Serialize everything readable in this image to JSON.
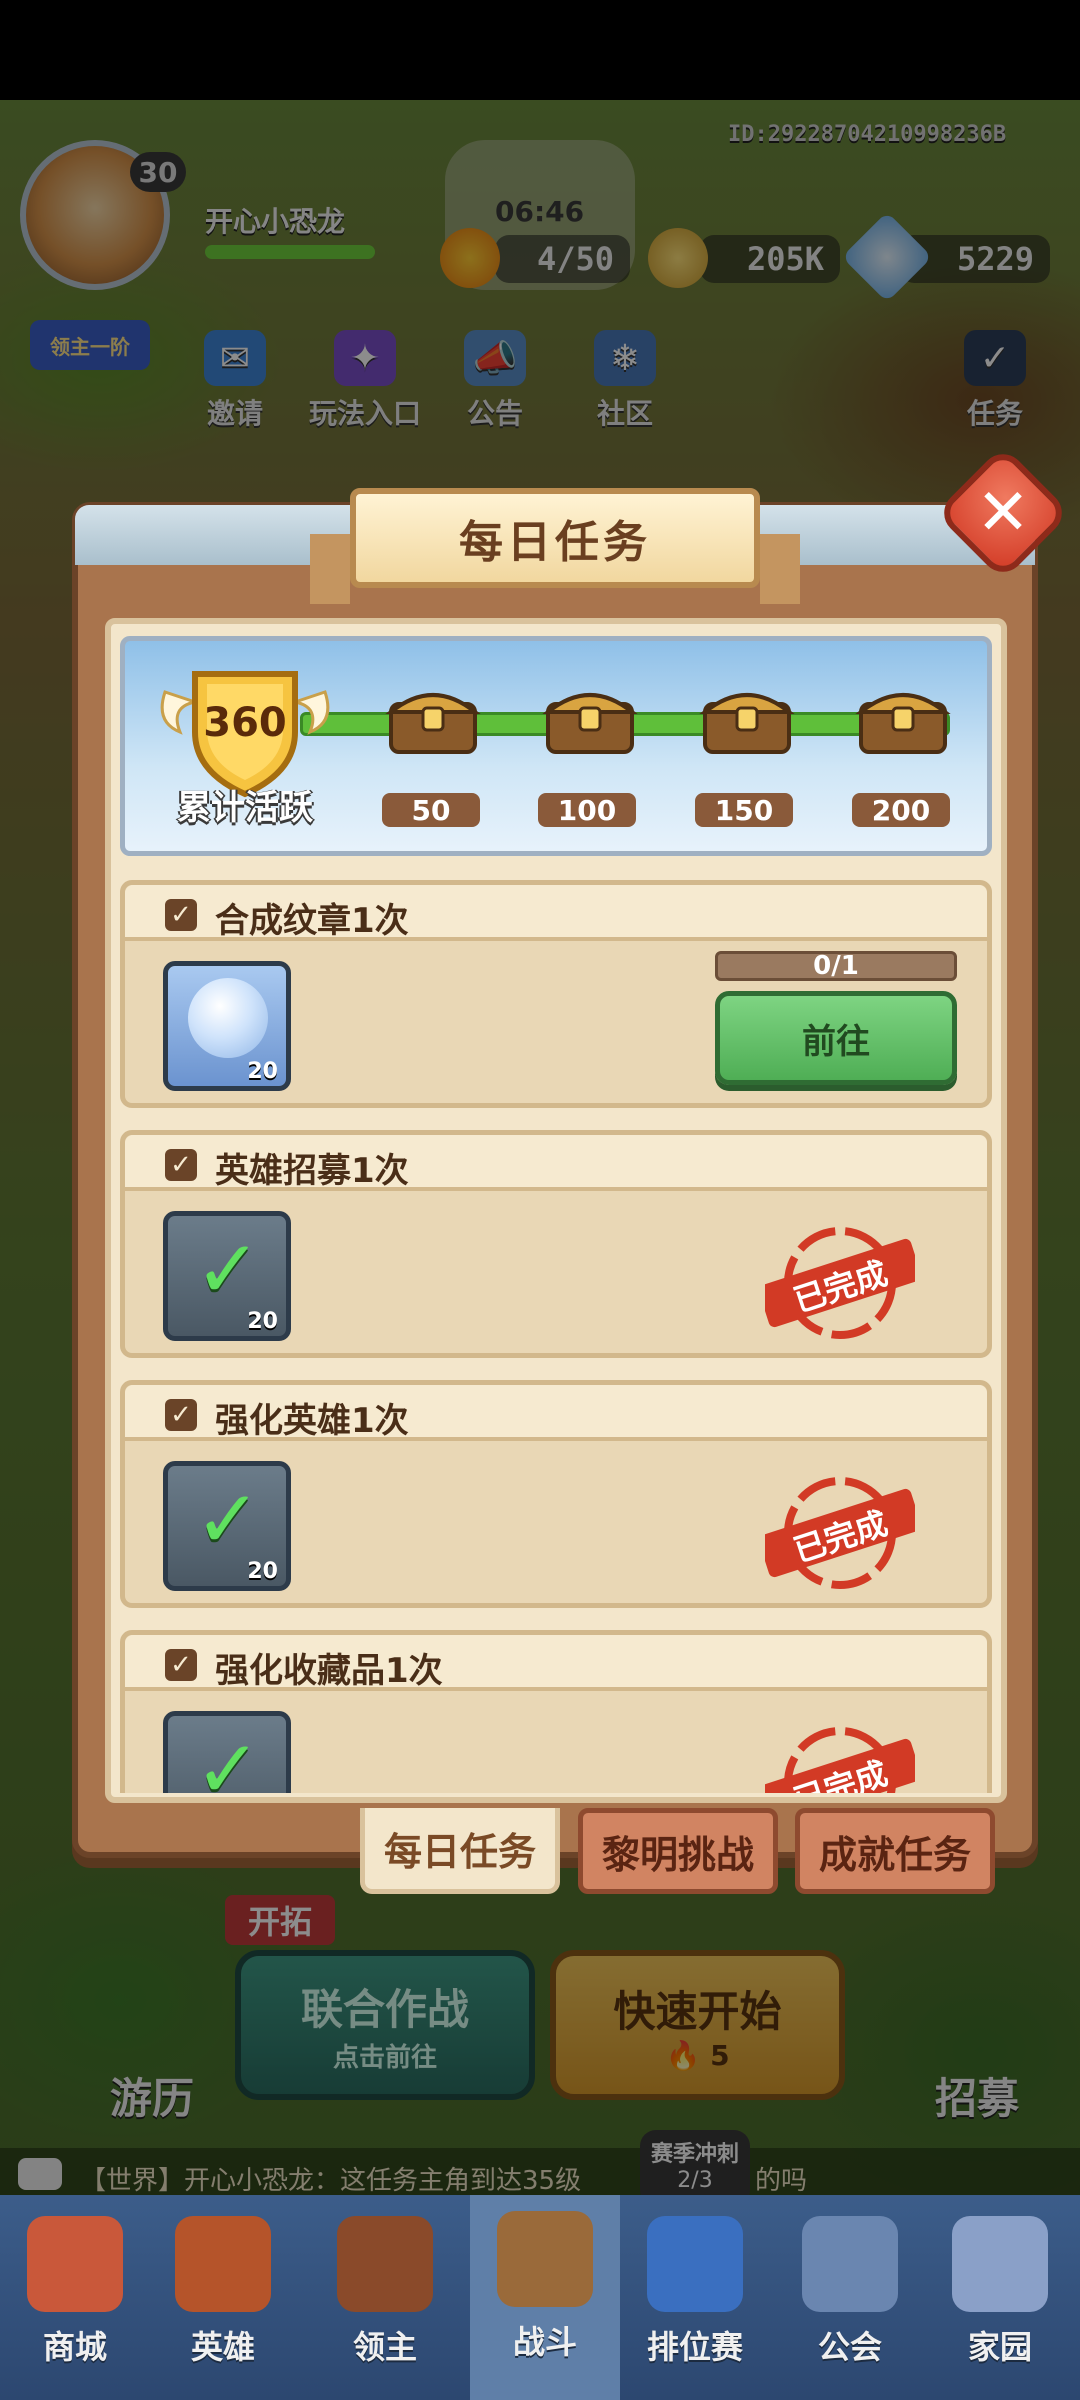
{
  "hud": {
    "player_name": "开心小恐龙",
    "player_level": "30",
    "rank_label": "领主一阶",
    "player_id": "ID:29228704210998236B",
    "timer": "06:46",
    "stamina": "4/50",
    "gold": "205K",
    "gems": "5229",
    "shortcuts": [
      {
        "label": "邀请"
      },
      {
        "label": "玩法入口"
      },
      {
        "label": "公告"
      },
      {
        "label": "社区"
      }
    ],
    "side_task_label": "任务"
  },
  "modal": {
    "title": "每日任务",
    "activity": {
      "value": "360",
      "label": "累计活跃",
      "milestones": [
        "50",
        "100",
        "150",
        "200"
      ]
    },
    "tasks": [
      {
        "title": "合成纹章1次",
        "reward_count": "20",
        "progress": "0/1",
        "action": "前往",
        "completed": false
      },
      {
        "title": "英雄招募1次",
        "reward_count": "20",
        "status": "已完成",
        "completed": true
      },
      {
        "title": "强化英雄1次",
        "reward_count": "20",
        "status": "已完成",
        "completed": true
      },
      {
        "title": "强化收藏品1次",
        "status": "已完成",
        "completed": true
      }
    ],
    "tabs": [
      "每日任务",
      "黎明挑战",
      "成就任务"
    ]
  },
  "lower": {
    "tag": "开拓",
    "coop_title": "联合作战",
    "coop_sub": "点击前往",
    "quick_title": "快速开始",
    "quick_cost": "5",
    "left_label": "游历",
    "right_label": "招募",
    "chat": "【世界】开心小恐龙：这任务主角到达35级",
    "chat_tail": "的吗",
    "season": "赛季冲刺",
    "season_progress": "2/3"
  },
  "nav": [
    "商城",
    "英雄",
    "领主",
    "战斗",
    "排位赛",
    "公会",
    "家园"
  ],
  "colors": {
    "accent_green": "#4fae55",
    "stamp_red": "#d23a25",
    "panel_bg": "#f3e6cb",
    "frame_brown": "#a9744d"
  }
}
